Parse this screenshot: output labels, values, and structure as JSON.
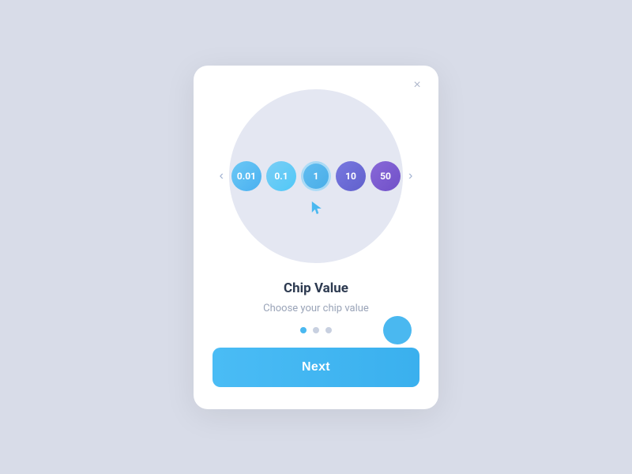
{
  "modal": {
    "close_icon": "×",
    "title": "Chip Value",
    "description": "Choose your chip value",
    "next_button_label": "Next"
  },
  "chips": [
    {
      "label": "0.01",
      "class": "chip-1"
    },
    {
      "label": "0.1",
      "class": "chip-2"
    },
    {
      "label": "1",
      "class": "chip-3"
    },
    {
      "label": "10",
      "class": "chip-4"
    },
    {
      "label": "50",
      "class": "chip-5"
    }
  ],
  "arrows": {
    "left": "‹",
    "right": "›"
  },
  "dots": [
    {
      "active": true
    },
    {
      "active": false
    },
    {
      "active": false
    }
  ]
}
